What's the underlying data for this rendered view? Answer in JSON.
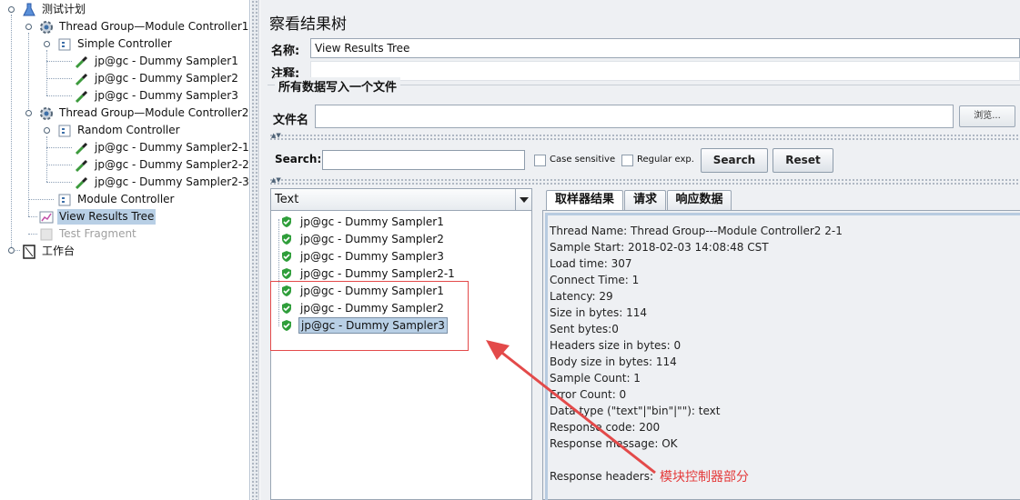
{
  "tree": {
    "items": [
      {
        "label": "测试计划",
        "icon": "flask-icon"
      },
      {
        "label": "Thread Group—Module Controller1",
        "icon": "gear-icon"
      },
      {
        "label": "Simple Controller",
        "icon": "controller-icon"
      },
      {
        "label": "jp@gc - Dummy Sampler1",
        "icon": "dropper-icon"
      },
      {
        "label": "jp@gc - Dummy Sampler2",
        "icon": "dropper-icon"
      },
      {
        "label": "jp@gc - Dummy Sampler3",
        "icon": "dropper-icon"
      },
      {
        "label": "Thread Group—Module Controller2",
        "icon": "gear-icon"
      },
      {
        "label": "Random Controller",
        "icon": "controller-icon"
      },
      {
        "label": "jp@gc - Dummy Sampler2-1",
        "icon": "dropper-icon"
      },
      {
        "label": "jp@gc - Dummy Sampler2-2",
        "icon": "dropper-icon"
      },
      {
        "label": "jp@gc - Dummy Sampler2-3",
        "icon": "dropper-icon"
      },
      {
        "label": "Module Controller",
        "icon": "controller-icon"
      },
      {
        "label": "View Results Tree",
        "icon": "chart-icon"
      },
      {
        "label": "Test Fragment",
        "icon": "fragment-icon"
      },
      {
        "label": "工作台",
        "icon": "workbench-icon"
      }
    ]
  },
  "panel": {
    "title": "察看结果树",
    "name_label": "名称:",
    "name_value": "View Results Tree",
    "comment_label": "注释:",
    "file_group_title": "所有数据写入一个文件",
    "file_label": "文件名",
    "browse_label": "浏览..."
  },
  "search": {
    "label": "Search:",
    "case_sensitive": "Case sensitive",
    "regex": "Regular exp.",
    "search_button": "Search",
    "reset_button": "Reset"
  },
  "results": {
    "renderer": "Text",
    "items": [
      "jp@gc - Dummy Sampler1",
      "jp@gc - Dummy Sampler2",
      "jp@gc - Dummy Sampler3",
      "jp@gc - Dummy Sampler2-1",
      "jp@gc - Dummy Sampler1",
      "jp@gc - Dummy Sampler2",
      "jp@gc - Dummy Sampler3"
    ]
  },
  "tabs": [
    "取样器结果",
    "请求",
    "响应数据"
  ],
  "detail": {
    "lines": [
      "Thread Name: Thread Group---Module Controller2 2-1",
      "Sample Start: 2018-02-03 14:08:48 CST",
      "Load time: 307",
      "Connect Time: 1",
      "Latency: 29",
      "Size in bytes: 114",
      "Sent bytes:0",
      "Headers size in bytes: 0",
      "Body size in bytes: 114",
      "Sample Count: 1",
      "Error Count: 0",
      "Data type (\"text\"|\"bin\"|\"\"): text",
      "Response code: 200",
      "Response message: OK",
      "",
      "Response headers:"
    ]
  },
  "annotation": {
    "text": "模块控制器部分",
    "color": "#e34a4a"
  }
}
